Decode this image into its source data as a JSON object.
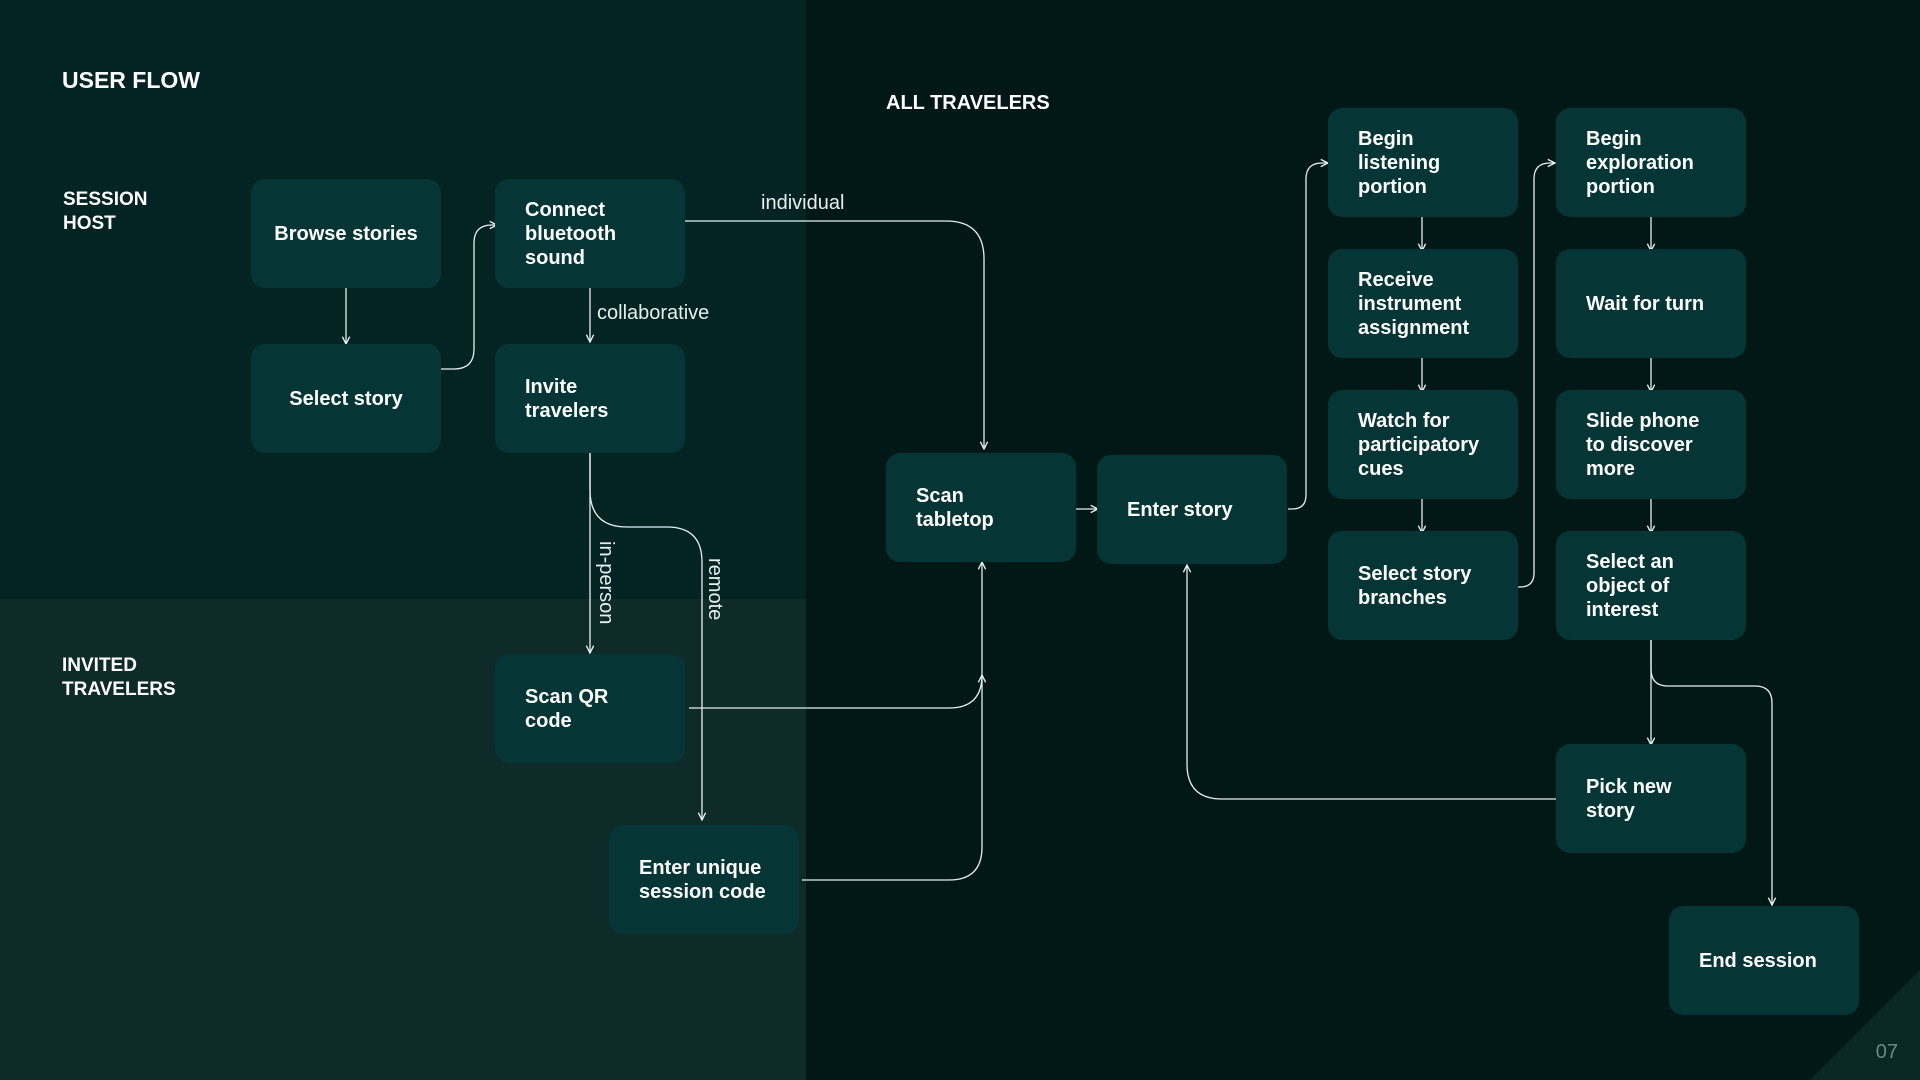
{
  "title": "USER FLOW",
  "lanes": {
    "host": "SESSION\nHOST",
    "invited": "INVITED\nTRAVELERS",
    "all": "ALL TRAVELERS"
  },
  "nodes": {
    "browse_stories": "Browse stories",
    "select_story": "Select story",
    "connect_bluetooth": "Connect\nbluetooth\nsound",
    "invite_travelers": "Invite\ntravelers",
    "scan_qr": "Scan QR\ncode",
    "enter_code": "Enter unique\nsession code",
    "scan_tabletop": "Scan\ntabletop",
    "enter_story": "Enter story",
    "begin_listening": "Begin\nlistening\nportion",
    "receive_instrument": "Receive\ninstrument\nassignment",
    "watch_cues": "Watch for\nparticipatory\ncues",
    "select_branches": "Select story\nbranches",
    "begin_exploration": "Begin\nexploration\nportion",
    "wait_turn": "Wait for turn",
    "slide_phone": "Slide phone\nto discover\nmore",
    "select_object": "Select an\nobject of\ninterest",
    "pick_new_story": "Pick new\nstory",
    "end_session": "End session"
  },
  "edge_labels": {
    "individual": "individual",
    "collaborative": "collaborative",
    "in_person": "in-person",
    "remote": "remote"
  },
  "page_number": "07",
  "colors": {
    "host_panel": "#032423",
    "invited_panel": "#0e2a29",
    "all_panel": "#021817",
    "node_fill": "#053534",
    "connector": "#e6efee"
  }
}
